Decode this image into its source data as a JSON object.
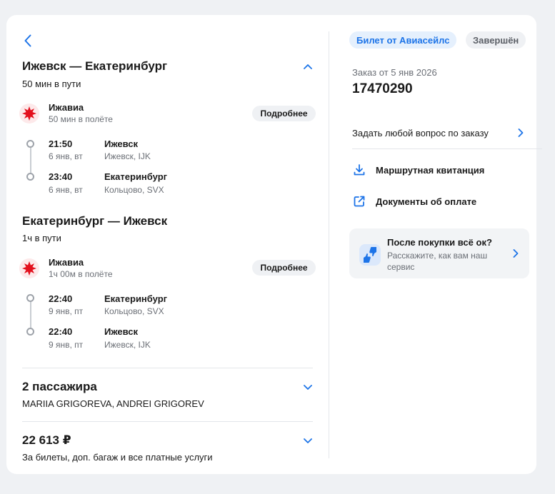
{
  "segments": [
    {
      "title": "Ижевск — Екатеринбург",
      "travel_time": "50 мин в пути",
      "airline": "Ижавиа",
      "flight_time": "50 мин в полёте",
      "details_label": "Подробнее",
      "departure": {
        "time": "21:50",
        "date": "6 янв, вт",
        "city": "Ижевск",
        "airport": "Ижевск, IJK"
      },
      "arrival": {
        "time": "23:40",
        "date": "6 янв, вт",
        "city": "Екатеринбург",
        "airport": "Кольцово, SVX"
      }
    },
    {
      "title": "Екатеринбург — Ижевск",
      "travel_time": "1ч в пути",
      "airline": "Ижавиа",
      "flight_time": "1ч 00м в полёте",
      "details_label": "Подробнее",
      "departure": {
        "time": "22:40",
        "date": "9 янв, пт",
        "city": "Екатеринбург",
        "airport": "Кольцово, SVX"
      },
      "arrival": {
        "time": "22:40",
        "date": "9 янв, пт",
        "city": "Ижевск",
        "airport": "Ижевск, IJK"
      }
    }
  ],
  "passengers": {
    "title": "2 пассажира",
    "names": "MARIIA GRIGOREVA, ANDREI GRIGOREV"
  },
  "price": {
    "total": "22 613 ₽",
    "description": "За билеты, доп. багаж и все платные услуги"
  },
  "order": {
    "badge_source": "Билет от Авиасейлс",
    "badge_status": "Завершён",
    "date_label": "Заказ от 5 янв 2026",
    "number": "17470290"
  },
  "actions": {
    "ask_question": "Задать любой вопрос по заказу",
    "itinerary_receipt": "Маршрутная квитанция",
    "payment_documents": "Документы об оплате"
  },
  "feedback": {
    "title": "После покупки всё ок?",
    "text": "Расскажите, как вам наш сервис"
  },
  "icons": {
    "back": "chevron-left-icon",
    "collapse": "chevron-up-icon",
    "expand": "chevron-down-icon",
    "airline_logo": "izhavia-star-icon",
    "download": "download-icon",
    "external": "external-link-icon",
    "feedback": "thumbs-up-down-icon"
  },
  "colors": {
    "accent": "#1d74e8",
    "airline_red": "#e3101d",
    "background": "#eff1f4"
  }
}
